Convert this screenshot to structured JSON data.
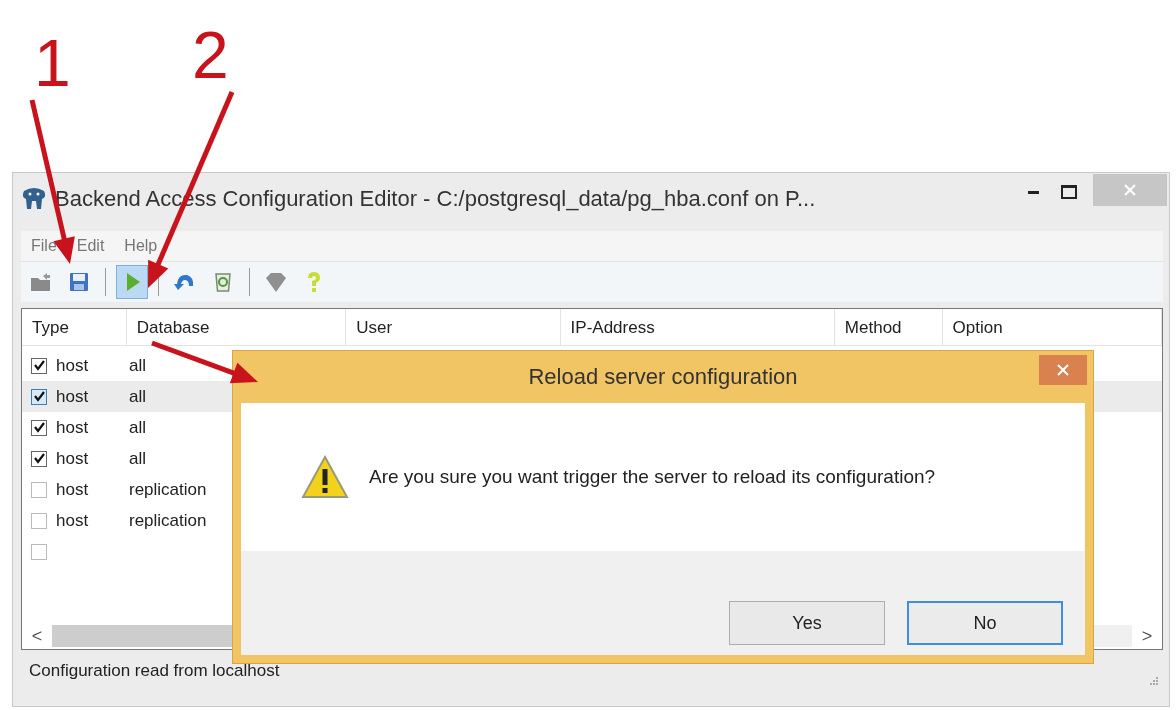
{
  "annotations": [
    {
      "label": "1",
      "kind": "save"
    },
    {
      "label": "2",
      "kind": "reload"
    }
  ],
  "window": {
    "title": "Backend Access Configuration Editor - C:/postgresql_data/pg_hba.conf on P..."
  },
  "menu": [
    {
      "label": "File"
    },
    {
      "label": "Edit"
    },
    {
      "label": "Help"
    }
  ],
  "toolbar": [
    {
      "kind": "open",
      "pressed": false
    },
    {
      "kind": "save",
      "pressed": false
    },
    {
      "kind": "separator"
    },
    {
      "kind": "reload",
      "pressed": true
    },
    {
      "kind": "separator"
    },
    {
      "kind": "undo",
      "pressed": false
    },
    {
      "kind": "recycle",
      "pressed": false
    },
    {
      "kind": "separator"
    },
    {
      "kind": "gem",
      "pressed": false
    },
    {
      "kind": "help",
      "pressed": false
    }
  ],
  "table": {
    "columns": [
      "Type",
      "Database",
      "User",
      "IP-Address",
      "Method",
      "Option"
    ],
    "rows": [
      {
        "checked": true,
        "type": "host",
        "database": "all",
        "selected": false
      },
      {
        "checked": true,
        "type": "host",
        "database": "all",
        "selected": true
      },
      {
        "checked": true,
        "type": "host",
        "database": "all",
        "selected": false
      },
      {
        "checked": true,
        "type": "host",
        "database": "all",
        "selected": false
      },
      {
        "checked": false,
        "type": "host",
        "database": "replication",
        "selected": false
      },
      {
        "checked": false,
        "type": "host",
        "database": "replication",
        "selected": false
      },
      {
        "checked": false,
        "selected": false
      }
    ],
    "scroll_left": "<",
    "scroll_right": ">"
  },
  "status_bar": "Configuration read from localhost",
  "dialog": {
    "title": "Reload server configuration",
    "message": "Are you sure you want trigger the server to reload its configuration?",
    "buttons": [
      {
        "label": "Yes",
        "focused": false
      },
      {
        "label": "No",
        "focused": true
      }
    ]
  }
}
